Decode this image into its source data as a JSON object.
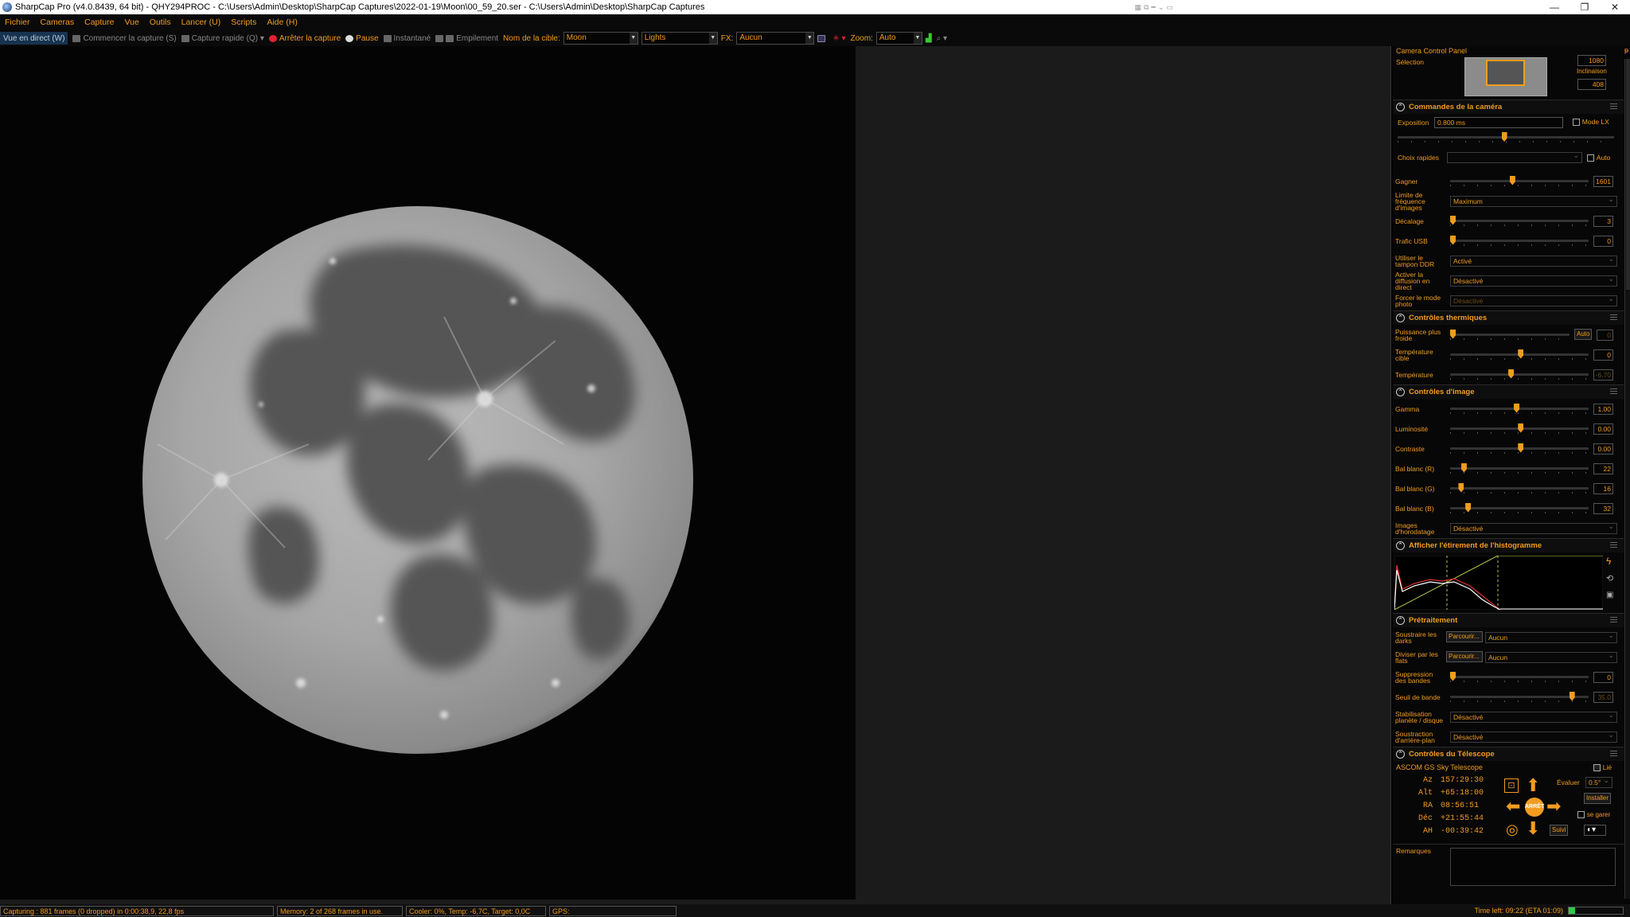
{
  "titlebar": {
    "title": "SharpCap Pro (v4.0.8439, 64 bit) - QHY294PROC - C:\\Users\\Admin\\Desktop\\SharpCap Captures\\2022-01-19\\Moon\\00_59_20.ser - C:\\Users\\Admin\\Desktop\\SharpCap Captures"
  },
  "menu": [
    "Fichier",
    "Cameras",
    "Capture",
    "Vue",
    "Outils",
    "Lancer (U)",
    "Scripts",
    "Aide (H)"
  ],
  "toolbar": {
    "live_view": "Vue en direct (W)",
    "start_capture": "Commencer la capture (S)",
    "quick_capture": "Capture rapide (Q)",
    "stop_capture": "Arrêter la capture",
    "pause": "Pause",
    "snapshot": "Instantané",
    "stacking": "Empilement",
    "target_label": "Nom de la cible:",
    "target_value": "Moon",
    "frame_type": "Lights",
    "fx_label": "FX:",
    "fx_value": "Aucun",
    "zoom_label": "Zoom:",
    "zoom_value": "Auto"
  },
  "panel": {
    "title": "Camera Control Panel",
    "selection_label": "Sélection",
    "roi_value_1": "1080",
    "inclinaison_label": "Inclinaison",
    "roi_value_2": "408",
    "camera_controls": {
      "header": "Commandes de la caméra",
      "exposure_label": "Exposition",
      "exposure_value": "0.800 ms",
      "lx_mode_label": "Mode LX",
      "quick_pick_label": "Choix rapides",
      "auto_label": "Auto",
      "gain_label": "Gagner",
      "gain_value": "1601",
      "frame_rate_label": "Limite de fréquence d'images",
      "frame_rate_value": "Maximum",
      "offset_label": "Décalage",
      "offset_value": "3",
      "usb_label": "Trafic USB",
      "usb_value": "0",
      "ddr_label": "Utiliser le tampon DDR",
      "ddr_value": "Activé",
      "live_stream_label": "Activer la diffusion en direct",
      "live_stream_value": "Désactivé",
      "photo_mode_label": "Forcer le mode photo",
      "photo_mode_value": "Désactivé"
    },
    "thermal": {
      "header": "Contrôles thermiques",
      "cooler_power_label": "Puissance plus froide",
      "cooler_auto": "Auto",
      "cooler_value": "0",
      "target_temp_label": "Température cible",
      "target_temp_value": "0",
      "temp_label": "Température",
      "temp_value": "-6,70"
    },
    "image": {
      "header": "Contrôles d'image",
      "gamma_label": "Gamma",
      "gamma_value": "1.00",
      "brightness_label": "Luminosité",
      "brightness_value": "0.00",
      "contrast_label": "Contraste",
      "contrast_value": "0.00",
      "wbr_label": "Bal blanc (R)",
      "wbr_value": "22",
      "wbg_label": "Bal blanc (G)",
      "wbg_value": "16",
      "wbb_label": "Bal blanc (B)",
      "wbb_value": "32",
      "timestamp_label": "Images d'horodatage",
      "timestamp_value": "Désactivé"
    },
    "histogram": {
      "header": "Afficher l'étirement de l'histogramme"
    },
    "preprocessing": {
      "header": "Prétraitement",
      "darks_label": "Soustraire les darks",
      "browse": "Parcourir...",
      "darks_value": "Aucun",
      "flats_label": "Diviser par les flats",
      "flats_value": "Aucun",
      "banding_label": "Suppression des bandes",
      "banding_value": "0",
      "band_threshold_label": "Seuil de bande",
      "band_threshold_value": "35.0",
      "stabilization_label": "Stabilisation planète / disque",
      "stabilization_value": "Désactivé",
      "bg_sub_label": "Soustraction d'arrière-plan",
      "bg_sub_value": "Désactivé"
    },
    "telescope": {
      "header": "Contrôles du Télescope",
      "name": "ASCOM GS Sky Telescope",
      "linked_label": "Lié",
      "rows": [
        {
          "label": "Az",
          "value": "157:29:30"
        },
        {
          "label": "Alt",
          "value": "+65:18:00"
        },
        {
          "label": "RA",
          "value": "08:56:51"
        },
        {
          "label": "Déc",
          "value": "+21:55:44"
        },
        {
          "label": "AH",
          "value": "-00:39:42"
        }
      ],
      "evaluate_label": "Évaluer",
      "rate_value": "0.5°",
      "install_button": "Installer",
      "park_label": "se garer",
      "stop_button": "ARRÊT",
      "follow_button": "Suivi"
    },
    "notes_label": "Remarques"
  },
  "status": {
    "capturing": "Capturing : 881 frames (0 dropped) in 0:00:38,9, 22,8 fps",
    "memory": "Memory: 2 of 268 frames in use.",
    "cooler": "Cooler: 0%, Temp: -6,7C, Target: 0,0C",
    "gps": "GPS:",
    "time_left": "Time left: 09:22 (ETA 01:09)"
  },
  "colors": {
    "accent": "#f29c1f",
    "background": "#000000"
  }
}
